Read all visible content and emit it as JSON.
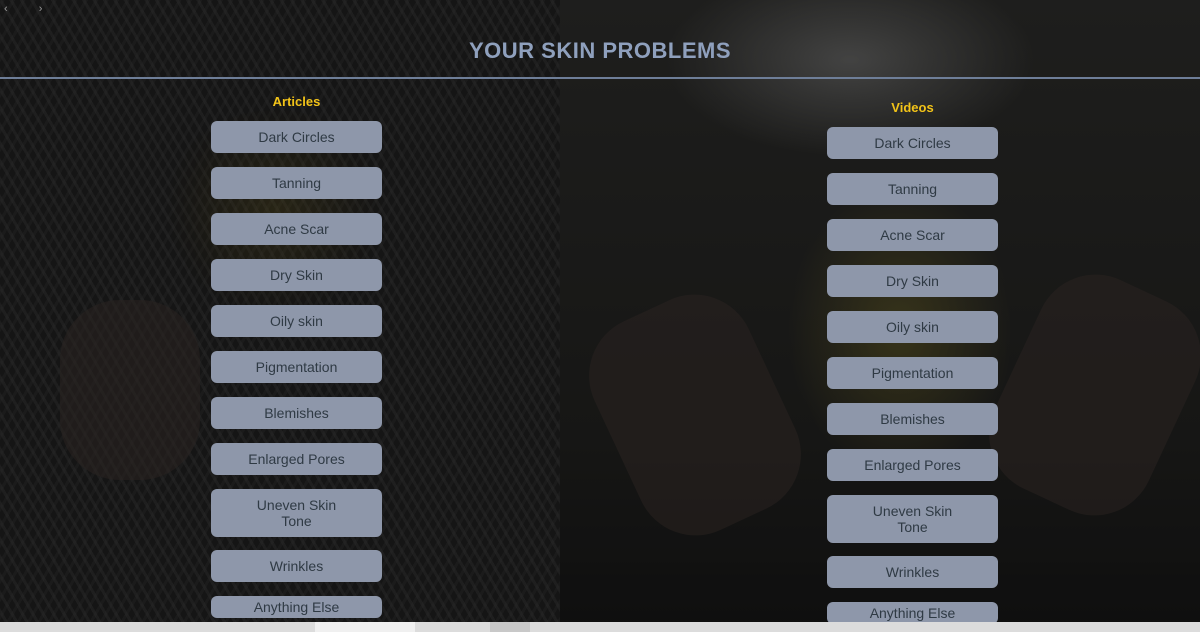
{
  "header": {
    "title": "YOUR SKIN PROBLEMS",
    "nav_arrows": "‹ ›"
  },
  "articles": {
    "heading": "Articles",
    "items": [
      "Dark Circles",
      "Tanning",
      "Acne Scar",
      "Dry Skin",
      "Oily skin",
      "Pigmentation",
      "Blemishes",
      "Enlarged Pores",
      "Uneven Skin Tone",
      "Wrinkles",
      "Anything Else"
    ]
  },
  "videos": {
    "heading": "Videos",
    "items": [
      "Dark Circles",
      "Tanning",
      "Acne Scar",
      "Dry Skin",
      "Oily skin",
      "Pigmentation",
      "Blemishes",
      "Enlarged Pores",
      "Uneven Skin Tone",
      "Wrinkles",
      "Anything Else"
    ]
  },
  "colors": {
    "title": "#8fa0bd",
    "heading": "#f2c318",
    "button_bg": "#8e97aa",
    "button_text": "#2f3a44"
  }
}
